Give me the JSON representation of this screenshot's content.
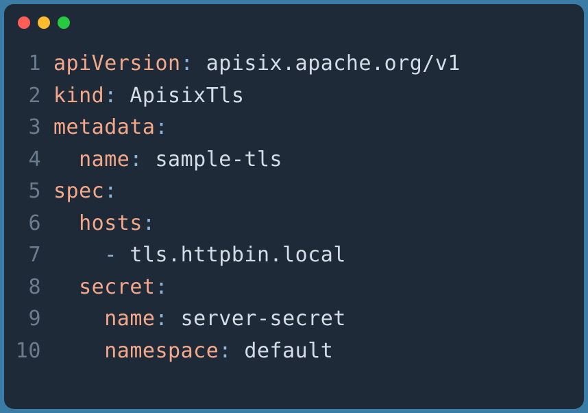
{
  "code": {
    "lines": [
      {
        "num": "1",
        "indent": "",
        "key": "apiVersion",
        "value": " apisix.apache.org/v1"
      },
      {
        "num": "2",
        "indent": "",
        "key": "kind",
        "value": " ApisixTls"
      },
      {
        "num": "3",
        "indent": "",
        "key": "metadata",
        "value": ""
      },
      {
        "num": "4",
        "indent": "  ",
        "key": "name",
        "value": " sample-tls"
      },
      {
        "num": "5",
        "indent": "",
        "key": "spec",
        "value": ""
      },
      {
        "num": "6",
        "indent": "  ",
        "key": "hosts",
        "value": ""
      },
      {
        "num": "7",
        "indent": "    ",
        "dash": "- ",
        "listval": "tls.httpbin.local"
      },
      {
        "num": "8",
        "indent": "  ",
        "key": "secret",
        "value": ""
      },
      {
        "num": "9",
        "indent": "    ",
        "key": "name",
        "value": " server-secret"
      },
      {
        "num": "10",
        "indent": "    ",
        "key": "namespace",
        "value": " default"
      }
    ]
  }
}
